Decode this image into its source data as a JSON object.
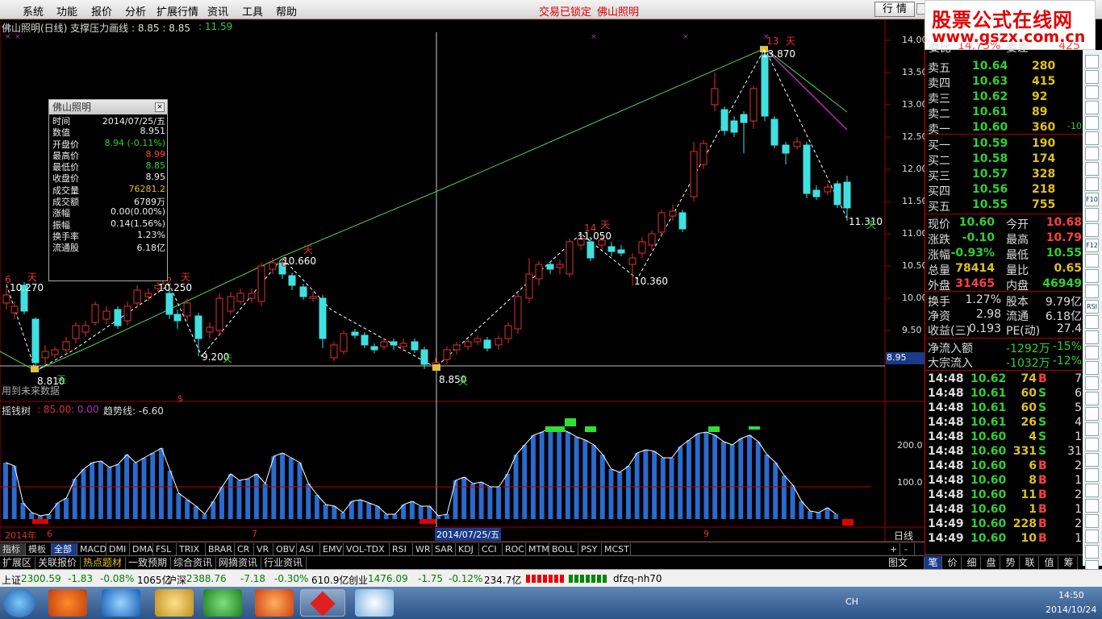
{
  "menu": {
    "items": [
      "系统",
      "功能",
      "报价",
      "分析",
      "扩展行情",
      "资讯",
      "工具",
      "帮助"
    ],
    "status_left": "交易已锁定",
    "status_right": "佛山照明",
    "quote_tab": "行 情"
  },
  "banner": {
    "line1": "股票公式在线网",
    "line2": "www.gszx.com.cn"
  },
  "chart": {
    "title": "佛山照明(日线) 支撑压力画线 : 8.85 : 8.85",
    "title_value": ": 11.59",
    "y_axis_labels": [
      "14.00",
      "13.50",
      "13.00",
      "12.50",
      "12.00",
      "11.50",
      "11.00",
      "10.50",
      "10.00",
      "9.50"
    ],
    "current_price_label": "8.95",
    "annotations": [
      {
        "text": "6",
        "color": "#e03030"
      },
      {
        "text": "天",
        "color": "#e03030"
      },
      {
        "text": "10.270",
        "color": "#ffffff"
      },
      {
        "text": "12",
        "color": "#e03030"
      },
      {
        "text": "天",
        "color": "#e03030"
      },
      {
        "text": "10.250",
        "color": "#ffffff"
      },
      {
        "text": "6",
        "color": "#e03030"
      },
      {
        "text": "天",
        "color": "#e03030"
      },
      {
        "text": "10.660",
        "color": "#ffffff"
      },
      {
        "text": "14",
        "color": "#e03030"
      },
      {
        "text": "天",
        "color": "#e03030"
      },
      {
        "text": "11.050",
        "color": "#ffffff"
      },
      {
        "text": "13",
        "color": "#e03030"
      },
      {
        "text": "天",
        "color": "#e03030"
      },
      {
        "text": "13.870",
        "color": "#ffffff"
      },
      {
        "text": "9.200",
        "color": "#ffffff"
      },
      {
        "text": "天",
        "color": "#30c030"
      },
      {
        "text": "8.810",
        "color": "#ffffff"
      },
      {
        "text": "天",
        "color": "#30c030"
      },
      {
        "text": "8.850",
        "color": "#ffffff"
      },
      {
        "text": "天",
        "color": "#30c030"
      },
      {
        "text": "10.360",
        "color": "#ffffff"
      },
      {
        "text": "11.310",
        "color": "#ffffff"
      },
      {
        "text": "天",
        "color": "#30c030"
      },
      {
        "text": "用到未来数据",
        "color": "#aaaaaa"
      }
    ],
    "indicator_title": "摇钱树",
    "indicator_v1": ": 85.00",
    "indicator_v2": ": 0.00",
    "indicator_trend": "趋势线: -6.60",
    "indicator_y_labels": [
      "200.0",
      "100.0"
    ],
    "x_labels": [
      "2014年",
      "6",
      "7",
      "2014/07/25/五",
      "9"
    ],
    "period_label": "日线"
  },
  "info_box": {
    "title": "佛山照明",
    "rows": [
      {
        "k": "时间",
        "v": "2014/07/25/五",
        "c": "#eeeeee"
      },
      {
        "k": "数值",
        "v": "8.951",
        "c": "#eeeeee"
      },
      {
        "k": "开盘价",
        "v": "8.94 (-0.11%)",
        "c": "#30d030"
      },
      {
        "k": "最高价",
        "v": "8.99",
        "c": "#ff4040"
      },
      {
        "k": "最低价",
        "v": "8.85",
        "c": "#30d030"
      },
      {
        "k": "收盘价",
        "v": "8.95",
        "c": "#eeeeee"
      },
      {
        "k": "成交量",
        "v": "76281.2",
        "c": "#e0c020"
      },
      {
        "k": "成交额",
        "v": "6789万",
        "c": "#eeeeee"
      },
      {
        "k": "涨幅",
        "v": "0.00(0.00%)",
        "c": "#eeeeee"
      },
      {
        "k": "振幅",
        "v": "0.14(1.56%)",
        "c": "#eeeeee"
      },
      {
        "k": "换手率",
        "v": "1.23%",
        "c": "#eeeeee"
      },
      {
        "k": "流通股",
        "v": "6.18亿",
        "c": "#eeeeee"
      }
    ]
  },
  "indicator_tabs": [
    "指标",
    "模板",
    "全部",
    "MACD",
    "DMI",
    "DMA",
    "FSL",
    "TRIX",
    "BRAR",
    "CR",
    "VR",
    "OBV",
    "ASI",
    "EMV",
    "VOL-TDX",
    "RSI",
    "WR",
    "SAR",
    "KDJ",
    "CCI",
    "ROC",
    "MTM",
    "BOLL",
    "PSY",
    "MCST"
  ],
  "bottom_tabs": [
    "扩展区",
    "关联报价",
    "热点题材",
    "一致预期",
    "综合资讯",
    "网摘资讯",
    "行业资讯"
  ],
  "bottom_right": "图文F10",
  "order_book": {
    "header": {
      "label": "委比",
      "value": "14.73%",
      "label2": "委差",
      "value2": "425"
    },
    "sell": [
      {
        "label": "卖五",
        "price": "10.64",
        "vol": "280",
        "extra": ""
      },
      {
        "label": "卖四",
        "price": "10.63",
        "vol": "415",
        "extra": ""
      },
      {
        "label": "卖三",
        "price": "10.62",
        "vol": "92",
        "extra": ""
      },
      {
        "label": "卖二",
        "price": "10.61",
        "vol": "89",
        "extra": ""
      },
      {
        "label": "卖一",
        "price": "10.60",
        "vol": "360",
        "extra": "-10"
      }
    ],
    "buy": [
      {
        "label": "买一",
        "price": "10.59",
        "vol": "190"
      },
      {
        "label": "买二",
        "price": "10.58",
        "vol": "174"
      },
      {
        "label": "买三",
        "price": "10.57",
        "vol": "328"
      },
      {
        "label": "买四",
        "price": "10.56",
        "vol": "218"
      },
      {
        "label": "买五",
        "price": "10.55",
        "vol": "755"
      }
    ]
  },
  "quote_stats": [
    {
      "l1": "现价",
      "v1": "10.60",
      "c1": "#30d030",
      "l2": "今开",
      "v2": "10.68",
      "c2": "#ff4040"
    },
    {
      "l1": "涨跌",
      "v1": "-0.10",
      "c1": "#30d030",
      "l2": "最高",
      "v2": "10.79",
      "c2": "#ff4040"
    },
    {
      "l1": "涨幅",
      "v1": "-0.93%",
      "c1": "#30d030",
      "l2": "最低",
      "v2": "10.55",
      "c2": "#30d030"
    },
    {
      "l1": "总量",
      "v1": "78414",
      "c1": "#e0c020",
      "l2": "量比",
      "v2": "0.65",
      "c2": "#e0c020"
    },
    {
      "l1": "外盘",
      "v1": "31465",
      "c1": "#ff4040",
      "l2": "内盘",
      "v2": "46949",
      "c2": "#30d030"
    }
  ],
  "fund_stats": [
    {
      "l1": "换手",
      "v1": "1.27%",
      "l2": "股本",
      "v2": "9.79亿"
    },
    {
      "l1": "净资",
      "v1": "2.98",
      "l2": "流通",
      "v2": "6.18亿"
    },
    {
      "l1": "收益(三)",
      "v1": "0.193",
      "l2": "PE(动)",
      "v2": "27.4"
    }
  ],
  "flows": [
    {
      "label": "净流入额",
      "value": "-1292万",
      "pct": "-15%"
    },
    {
      "label": "大宗流入",
      "value": "-1032万",
      "pct": "-12%"
    }
  ],
  "ticks": [
    {
      "t": "14:48",
      "p": "10.62",
      "v": "74",
      "d": "B",
      "n": "7"
    },
    {
      "t": "14:48",
      "p": "10.61",
      "v": "60",
      "d": "S",
      "n": "6"
    },
    {
      "t": "14:48",
      "p": "10.61",
      "v": "60",
      "d": "S",
      "n": "5"
    },
    {
      "t": "14:48",
      "p": "10.61",
      "v": "26",
      "d": "S",
      "n": "4"
    },
    {
      "t": "14:48",
      "p": "10.60",
      "v": "4",
      "d": "S",
      "n": "1"
    },
    {
      "t": "14:48",
      "p": "10.60",
      "v": "331",
      "d": "S",
      "n": "31"
    },
    {
      "t": "14:48",
      "p": "10.60",
      "v": "6",
      "d": "B",
      "n": "2"
    },
    {
      "t": "14:48",
      "p": "10.60",
      "v": "8",
      "d": "B",
      "n": "1"
    },
    {
      "t": "14:48",
      "p": "10.60",
      "v": "11",
      "d": "B",
      "n": "2"
    },
    {
      "t": "14:48",
      "p": "10.60",
      "v": "1",
      "d": "B",
      "n": "1"
    },
    {
      "t": "14:49",
      "p": "10.60",
      "v": "228",
      "d": "B",
      "n": "2"
    },
    {
      "t": "14:49",
      "p": "10.60",
      "v": "10",
      "d": "B",
      "n": "1"
    }
  ],
  "rp_tabs": [
    "笔",
    "价",
    "细",
    "盘",
    "势",
    "联",
    "值",
    "筹"
  ],
  "side_icons": [
    "RSI",
    "F10",
    "F12"
  ],
  "index_bar": {
    "sh_label": "上证",
    "sh_val": "2300.59",
    "sh_chg": "-1.83",
    "sh_pct": "-0.08%",
    "sh_amt": "1065亿",
    "sz_label": "沪深",
    "sz_val": "2388.76",
    "sz_chg": "-7.18",
    "sz_pct": "-0.30%",
    "sz_amt": "610.9亿",
    "cy_label": "创业",
    "cy_val": "1476.09",
    "cy_chg": "-1.75",
    "cy_pct": "-0.12%",
    "cy_amt": "234.7亿",
    "server": "dfzq-nh70"
  },
  "taskbar": {
    "lang": "CH",
    "time": "14:50",
    "date": "2014/10/24"
  },
  "colors": {
    "up": "#e03030",
    "down": "#40e0e0",
    "support_line": "#50d050",
    "resistance_line": "#b030b0",
    "indicator_bar": "#2a6bd0"
  }
}
